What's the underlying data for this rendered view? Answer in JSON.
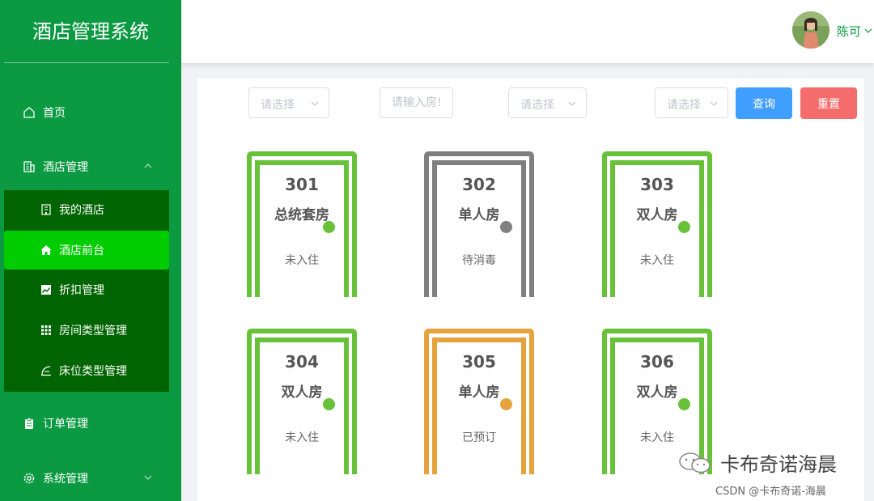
{
  "app": {
    "title": "酒店管理系统"
  },
  "sidebar": {
    "items": [
      {
        "label": "首页",
        "icon": "home-outline-icon"
      },
      {
        "label": "酒店管理",
        "icon": "building-icon"
      },
      {
        "label": "订单管理",
        "icon": "clipboard-icon"
      },
      {
        "label": "系统管理",
        "icon": "gear-icon"
      }
    ],
    "submenu": [
      {
        "label": "我的酒店",
        "icon": "building-outline-icon"
      },
      {
        "label": "酒店前台",
        "icon": "home-icon",
        "active": true
      },
      {
        "label": "折扣管理",
        "icon": "trend-chart-icon"
      },
      {
        "label": "房间类型管理",
        "icon": "grid-icon"
      },
      {
        "label": "床位类型管理",
        "icon": "bed-icon"
      }
    ]
  },
  "header": {
    "username": "陈可"
  },
  "filters": {
    "select1_placeholder": "请选择",
    "room_input_placeholder": "请输入房!",
    "select2_placeholder": "请选择",
    "select3_placeholder": "请选择",
    "query_label": "查询",
    "reset_label": "重置"
  },
  "rooms": [
    {
      "number": "301",
      "type": "总统套房",
      "status": "未入住",
      "color": "#67c23a"
    },
    {
      "number": "302",
      "type": "单人房",
      "status": "待消毒",
      "color": "#808080"
    },
    {
      "number": "303",
      "type": "双人房",
      "status": "未入住",
      "color": "#67c23a"
    },
    {
      "number": "304",
      "type": "双人房",
      "status": "未入住",
      "color": "#67c23a"
    },
    {
      "number": "305",
      "type": "单人房",
      "status": "已预订",
      "color": "#e6a23c"
    },
    {
      "number": "306",
      "type": "双人房",
      "status": "未入住",
      "color": "#67c23a"
    }
  ],
  "watermark": {
    "text": "卡布奇诺海晨",
    "csdn": "CSDN @卡布奇诺-海晨"
  },
  "colors": {
    "sidebar": "#0b9a42",
    "submenu": "#006400",
    "active": "#00cc00",
    "primary": "#409eff",
    "danger": "#f56c6c"
  }
}
